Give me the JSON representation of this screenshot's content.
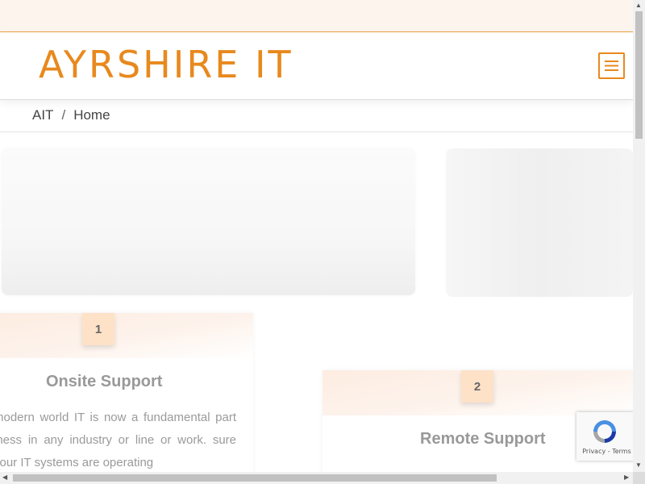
{
  "header": {
    "logo_text": "AYRSHIRE IT",
    "menu_icon": "hamburger-icon",
    "accent": "#e8891d"
  },
  "breadcrumb": {
    "items": [
      "AIT",
      "Home"
    ],
    "separator": "/"
  },
  "services": [
    {
      "number": "1",
      "title": "Onsite Support",
      "text": "modern world IT is now a fundamental part iness in any industry or line or work. sure your IT systems are operating"
    },
    {
      "number": "2",
      "title": "Remote Support",
      "text": ""
    }
  ],
  "recaptcha": {
    "icon": "recaptcha-icon",
    "links": "Privacy - Terms"
  },
  "colors": {
    "topbar_bg": "#fdf4ee",
    "badge_bg": "#fde2c8"
  }
}
